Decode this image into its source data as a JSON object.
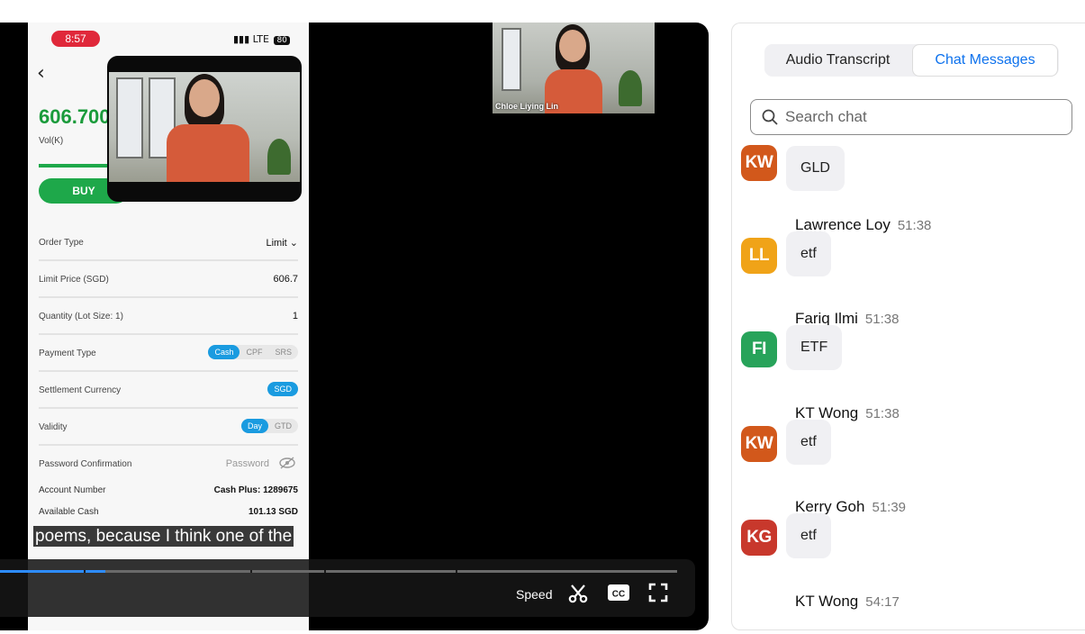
{
  "phone": {
    "time": "8:57",
    "network": "LTE",
    "battery": "80",
    "price": "606.700",
    "vol_label": "Vol(K)",
    "buy_label": "BUY",
    "form": {
      "order_type_label": "Order Type",
      "order_type_value": "Limit",
      "limit_price_label": "Limit Price (SGD)",
      "limit_price_value": "606.7",
      "quantity_label": "Quantity (Lot Size: 1)",
      "quantity_value": "1",
      "payment_type_label": "Payment Type",
      "payment_options": [
        "Cash",
        "CPF",
        "SRS"
      ],
      "settlement_label": "Settlement Currency",
      "settlement_value": "SGD",
      "validity_label": "Validity",
      "validity_options": [
        "Day",
        "GTD"
      ],
      "password_label": "Password Confirmation",
      "password_placeholder": "Password"
    },
    "account": {
      "number_label": "Account Number",
      "number_value": "Cash Plus: 1289675",
      "cash_label": "Available Cash",
      "cash_value": "101.13 SGD"
    }
  },
  "video": {
    "remote_participant": "Chloe Liying Lin",
    "caption": "poems, because I think one of the",
    "progress_fraction": 0.155,
    "speed_label": "Speed",
    "accent_color": "#2d8cff"
  },
  "chat_panel": {
    "tabs": [
      "Audio Transcript",
      "Chat Messages"
    ],
    "active_tab": "Chat Messages",
    "search_placeholder": "Search chat",
    "messages": [
      {
        "initials": "KW",
        "sender": "",
        "time": "",
        "text": "GLD",
        "color": "#d2581b"
      },
      {
        "initials": "LL",
        "sender": "Lawrence Loy",
        "time": "51:38",
        "text": "etf",
        "color": "#f0a318"
      },
      {
        "initials": "FI",
        "sender": "Fariq Ilmi",
        "time": "51:38",
        "text": "ETF",
        "color": "#27a35a"
      },
      {
        "initials": "KW",
        "sender": "KT Wong",
        "time": "51:38",
        "text": "etf",
        "color": "#d2581b"
      },
      {
        "initials": "KG",
        "sender": "Kerry Goh",
        "time": "51:39",
        "text": "etf",
        "color": "#c8382c"
      },
      {
        "initials": "",
        "sender": "KT Wong",
        "time": "54:17",
        "text": "",
        "color": "#d2581b"
      }
    ]
  }
}
